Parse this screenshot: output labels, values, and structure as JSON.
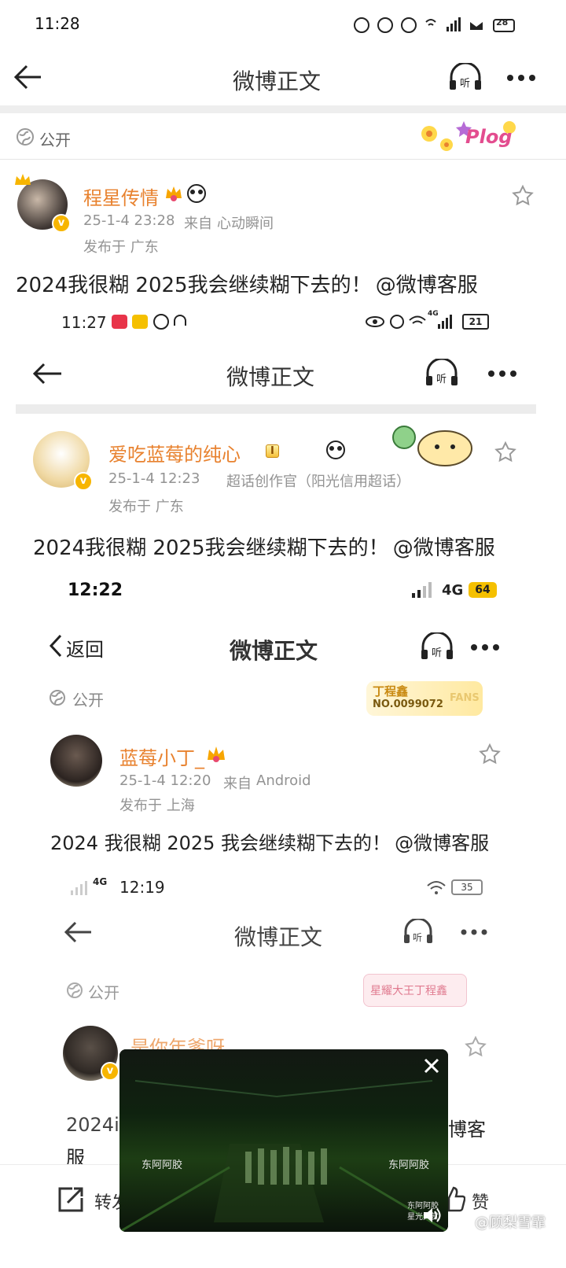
{
  "status_bar": {
    "time": "11:28",
    "battery": "28"
  },
  "header": {
    "title": "微博正文"
  },
  "visibility_label": "公开",
  "sticker_text": "Plog",
  "post": {
    "author": "程星传情",
    "timestamp": "25-1-4 23:28",
    "source_prefix": "来自",
    "source": "心动瞬间",
    "location": "发布于 广东",
    "text": "2024我很糊 2025我会继续糊下去的！",
    "mention": "@微博客服"
  },
  "shot2": {
    "status_time": "11:27",
    "battery": "21",
    "signal_label": "4G",
    "header_title": "微博正文",
    "author": "爱吃蓝莓的纯心",
    "vip_level": "I",
    "timestamp": "25-1-4 12:23",
    "source": "超话创作官（阳光信用超话）",
    "location": "发布于 广东",
    "text": "2024我很糊 2025我会继续糊下去的！",
    "mention": "@微博客服"
  },
  "shot3": {
    "status_time": "12:22",
    "network": "4G",
    "battery": "64",
    "back_label": "返回",
    "header_title": "微博正文",
    "visibility_label": "公开",
    "fan_card_name": "丁程鑫",
    "fan_card_no": "NO.0099072",
    "fan_card_suffix": "FANS",
    "author": "蓝莓小丁_",
    "timestamp": "25-1-4 12:20",
    "source_prefix": "来自",
    "source": "Android",
    "location": "发布于 上海",
    "text": "2024 我很糊 2025 我会继续糊下去的！",
    "mention": "@微博客服"
  },
  "shot4": {
    "status_time": "12:19",
    "network": "4G",
    "battery": "35",
    "header_title": "微博正文",
    "visibility_label": "公开",
    "badge_text": "星耀大王丁程鑫",
    "author": "是你年爹呀",
    "text_partial_left": "2024ⅰ",
    "text_partial_right": "博客",
    "text_line2": "服"
  },
  "video_overlay": {
    "watermark_left": "东阿阿胶",
    "watermark_right": "东阿阿胶",
    "watermark_small": "东阿阿胶",
    "watermark_small2": "星光大赏"
  },
  "bottom_bar": {
    "repost_label": "转发",
    "like_label": "赞"
  },
  "corner_watermark": "@顾梨雪霏",
  "colors": {
    "accent_orange": "#e8822f",
    "link_blue": "#4f76a8",
    "vip_gold": "#f5c03a"
  }
}
